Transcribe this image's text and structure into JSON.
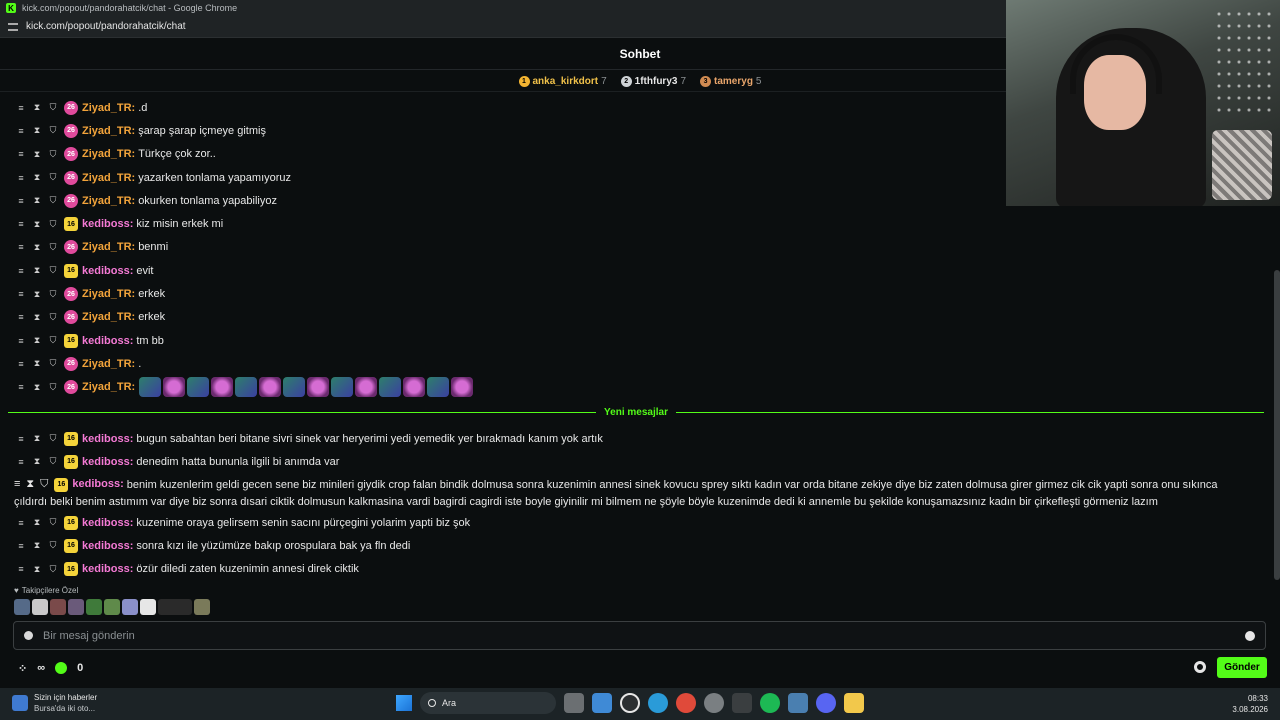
{
  "browser": {
    "window_title": "kick.com/popout/pandorahatcik/chat - Google Chrome",
    "url": "kick.com/popout/pandorahatcik/chat"
  },
  "chat": {
    "title": "Sohbet",
    "leaderboard": [
      {
        "rank": "1",
        "name": "anka_kirkdort",
        "count": "7",
        "color": "#f4b532",
        "name_color": "#f0c14a"
      },
      {
        "rank": "2",
        "name": "1fthfury3",
        "count": "7",
        "color": "#cfd3d6",
        "name_color": "#e6e6e6"
      },
      {
        "rank": "3",
        "name": "tameryg",
        "count": "5",
        "color": "#d08b52",
        "name_color": "#e9a56b"
      }
    ],
    "messages_before": [
      {
        "badge": "26",
        "badge_type": "pink",
        "user": "Ziyad_TR",
        "user_color": "orange",
        "text": ".d"
      },
      {
        "badge": "26",
        "badge_type": "pink",
        "user": "Ziyad_TR",
        "user_color": "orange",
        "text": "şarap şarap içmeye gitmiş"
      },
      {
        "badge": "26",
        "badge_type": "pink",
        "user": "Ziyad_TR",
        "user_color": "orange",
        "text": "Türkçe çok zor.."
      },
      {
        "badge": "26",
        "badge_type": "pink",
        "user": "Ziyad_TR",
        "user_color": "orange",
        "text": "yazarken tonlama yapamıyoruz"
      },
      {
        "badge": "26",
        "badge_type": "pink",
        "user": "Ziyad_TR",
        "user_color": "orange",
        "text": "okurken tonlama yapabiliyoz"
      },
      {
        "badge": "16",
        "badge_type": "yellow",
        "user": "kediboss",
        "user_color": "pink",
        "text": "kiz misin erkek mi"
      },
      {
        "badge": "26",
        "badge_type": "pink",
        "user": "Ziyad_TR",
        "user_color": "orange",
        "text": "benmi"
      },
      {
        "badge": "16",
        "badge_type": "yellow",
        "user": "kediboss",
        "user_color": "pink",
        "text": "evit"
      },
      {
        "badge": "26",
        "badge_type": "pink",
        "user": "Ziyad_TR",
        "user_color": "orange",
        "text": "erkek"
      },
      {
        "badge": "26",
        "badge_type": "pink",
        "user": "Ziyad_TR",
        "user_color": "orange",
        "text": "erkek"
      },
      {
        "badge": "16",
        "badge_type": "yellow",
        "user": "kediboss",
        "user_color": "pink",
        "text": "tm bb"
      },
      {
        "badge": "26",
        "badge_type": "pink",
        "user": "Ziyad_TR",
        "user_color": "orange",
        "text": "."
      }
    ],
    "emote_message": {
      "badge": "26",
      "user": "Ziyad_TR",
      "emote_count": 14
    },
    "new_messages_label": "Yeni mesajlar",
    "messages_after": [
      {
        "badge": "16",
        "user": "kediboss",
        "text": "bugun sabahtan beri bitane sivri sinek var heryerimi yedi yemedik yer bırakmadı kanım yok artık"
      },
      {
        "badge": "16",
        "user": "kediboss",
        "text": "denedim hatta bununla ilgili bi anımda var"
      }
    ],
    "long_message": {
      "badge": "16",
      "user": "kediboss",
      "text": "benim kuzenlerim geldi gecen sene biz minileri giydik crop falan bindik dolmusa sonra kuzenimin annesi sinek kovucu sprey sıktı kadın var orda bitane zekiye diye biz zaten dolmusa girer girmez cik cik yapti sonra onu sıkınca çıldırdı belki benim astımım var diye biz sonra dısari ciktik dolmusun kalkmasina vardi bagirdi cagirdi iste boyle giyinilir mi bilmem ne şöyle böyle kuzenimde dedi ki annemle bu şekilde konuşamazsınız kadın bir çirkefleşti görmeniz lazım"
    },
    "messages_last": [
      {
        "badge": "16",
        "user": "kediboss",
        "text": "kuzenime oraya gelirsem senin sacını pürçegini yolarim yapti biz şok"
      },
      {
        "badge": "16",
        "user": "kediboss",
        "text": "sonra kızı ile yüzümüze bakıp orospulara bak ya fln dedi"
      },
      {
        "badge": "16",
        "user": "kediboss",
        "text": "özür diledi zaten kuzenimin annesi direk ciktik"
      }
    ],
    "followers_only_label": "Takipçilere Özel",
    "input_placeholder": "Bir mesaj gönderin",
    "infinity_label": "∞",
    "points": "0",
    "send_label": "Gönder"
  },
  "taskbar": {
    "news_title": "Sizin için haberler",
    "news_sub": "Bursa'da iki oto...",
    "search_label": "Ara",
    "time": "08:33",
    "date": "3.08.2026"
  },
  "colors": {
    "accent": "#53fc18",
    "orange_user": "#f3a43b",
    "pink_user": "#f57ad5"
  }
}
